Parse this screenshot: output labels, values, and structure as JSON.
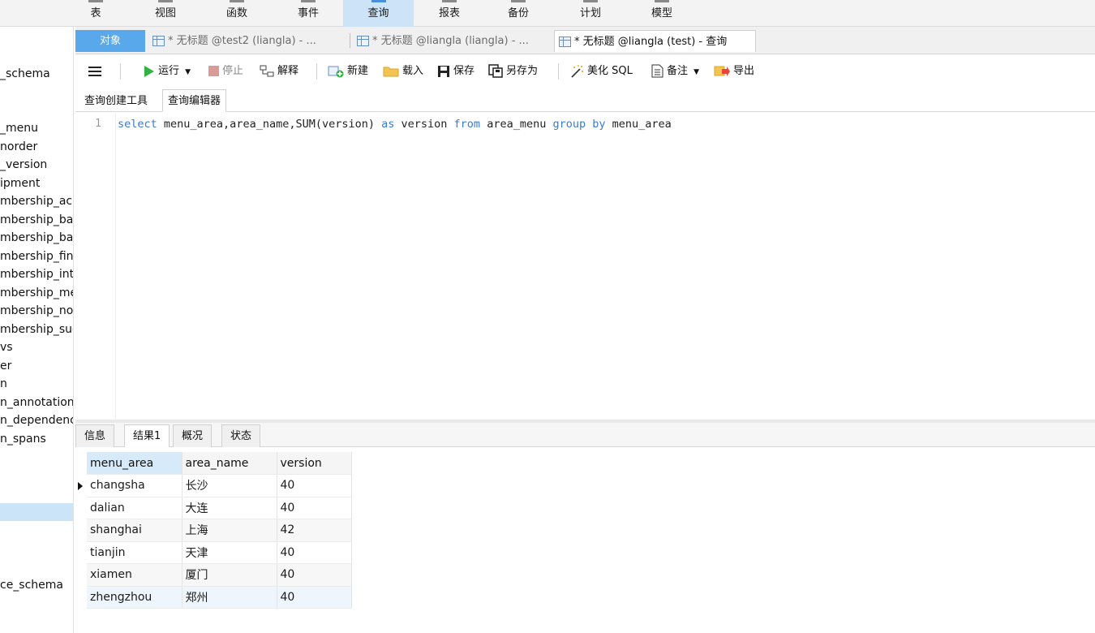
{
  "ribbon": {
    "items": [
      {
        "label": "表"
      },
      {
        "label": "视图"
      },
      {
        "label": "函数"
      },
      {
        "label": "事件"
      },
      {
        "label": "查询",
        "active": true
      },
      {
        "label": "报表"
      },
      {
        "label": "备份"
      },
      {
        "label": "计划"
      },
      {
        "label": "模型"
      }
    ]
  },
  "sidebar": {
    "items": [
      "_schema",
      "_menu",
      "norder",
      "_version",
      "ipment",
      "mbership_acc",
      "mbership_ba",
      "mbership_ba",
      "mbership_fin",
      "mbership_int",
      "mbership_me",
      "mbership_no",
      "mbership_sug",
      "vs",
      "er",
      "n",
      "n_annotation",
      "n_dependenc",
      "n_spans",
      "ce_schema"
    ]
  },
  "tabs": {
    "object_tab": "对象",
    "docs": [
      {
        "label": "* 无标题 @test2 (liangla) - ..."
      },
      {
        "label": "* 无标题 @liangla (liangla) - ..."
      },
      {
        "label": "* 无标题 @liangla (test) - 查询",
        "active": true
      }
    ]
  },
  "toolbar": {
    "menu_icon": "hamburger-icon",
    "run": "运行",
    "stop": "停止",
    "explain": "解释",
    "new": "新建",
    "load": "载入",
    "save": "保存",
    "save_as": "另存为",
    "beautify": "美化 SQL",
    "comment": "备注",
    "export": "导出"
  },
  "subtabs": {
    "builder": "查询创建工具",
    "editor": "查询编辑器"
  },
  "editor": {
    "line_number": "1",
    "tokens": [
      {
        "t": "select",
        "kw": true
      },
      {
        "t": " menu_area,area_name,SUM(version) ",
        "kw": false
      },
      {
        "t": "as",
        "kw": true
      },
      {
        "t": " version ",
        "kw": false
      },
      {
        "t": "from",
        "kw": true
      },
      {
        "t": " area_menu ",
        "kw": false
      },
      {
        "t": "group",
        "kw": true
      },
      {
        "t": " ",
        "kw": false
      },
      {
        "t": "by",
        "kw": true
      },
      {
        "t": " menu_area",
        "kw": false
      }
    ]
  },
  "result_tabs": {
    "info": "信息",
    "result1": "结果1",
    "overview": "概况",
    "status": "状态"
  },
  "grid": {
    "columns": [
      "menu_area",
      "area_name",
      "version"
    ],
    "rows": [
      [
        "changsha",
        "长沙",
        "40"
      ],
      [
        "dalian",
        "大连",
        "40"
      ],
      [
        "shanghai",
        "上海",
        "42"
      ],
      [
        "tianjin",
        "天津",
        "40"
      ],
      [
        "xiamen",
        "厦门",
        "40"
      ],
      [
        "zhengzhou",
        "郑州",
        "40"
      ]
    ]
  },
  "colors": {
    "accent": "#5aa8ec",
    "keyword": "#3a7bd5",
    "ribbon_active": "#cde3f7"
  }
}
